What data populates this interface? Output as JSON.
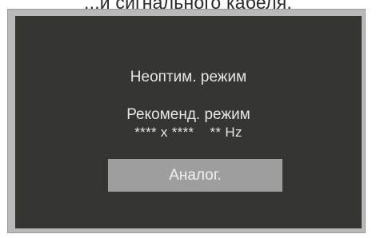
{
  "caption": "...и сигнального кабеля.",
  "osd": {
    "status_text": "Неоптим. режим",
    "recommend_label": "Рекоменд. режим",
    "recommend_value": "**** x ****    ** Hz",
    "input_button_label": "Аналог."
  }
}
